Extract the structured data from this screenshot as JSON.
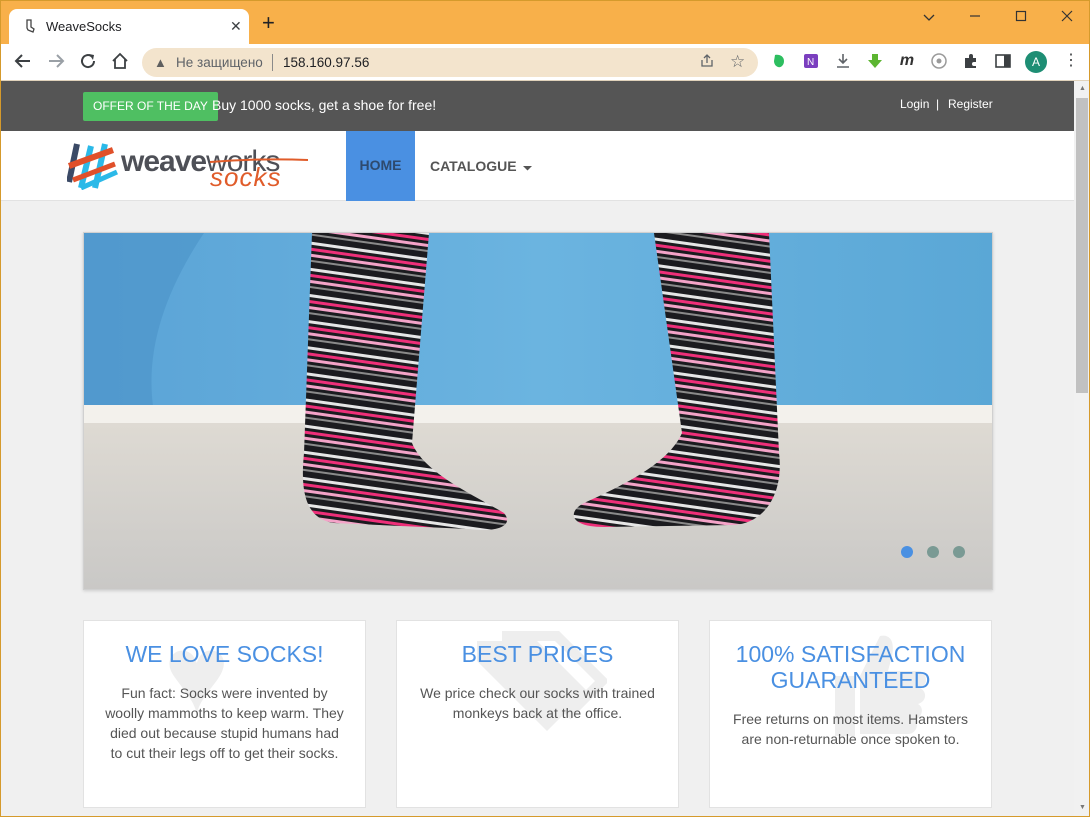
{
  "browser": {
    "tab_title": "WeaveSocks",
    "tab_close": "✕",
    "new_tab": "+",
    "security_label": "Не защищено",
    "url": "158.160.97.56",
    "profile_initial": "A"
  },
  "topbar": {
    "offer_badge": "OFFER OF THE DAY",
    "offer_text": "Buy 1000 socks, get a shoe for free!",
    "login": "Login",
    "separator": "|",
    "register": "Register"
  },
  "logo": {
    "weave": "weave",
    "works": "works",
    "socks": "socks"
  },
  "nav": {
    "home": "HOME",
    "catalogue": "CATALOGUE"
  },
  "carousel": {
    "slides": 3,
    "active_index": 0
  },
  "features": [
    {
      "title": "WE LOVE SOCKS!",
      "text": "Fun fact: Socks were invented by woolly mammoths to keep warm. They died out because stupid humans had to cut their legs off to get their socks."
    },
    {
      "title": "BEST PRICES",
      "text": "We price check our socks with trained monkeys back at the office."
    },
    {
      "title": "100% SATISFACTION GUARANTEED",
      "text": "Free returns on most items. Hamsters are non-returnable once spoken to."
    }
  ],
  "colors": {
    "titlebar": "#f8b04a",
    "accent": "#4a90e2",
    "offer_green": "#4fbf62",
    "topbar_gray": "#555555"
  }
}
